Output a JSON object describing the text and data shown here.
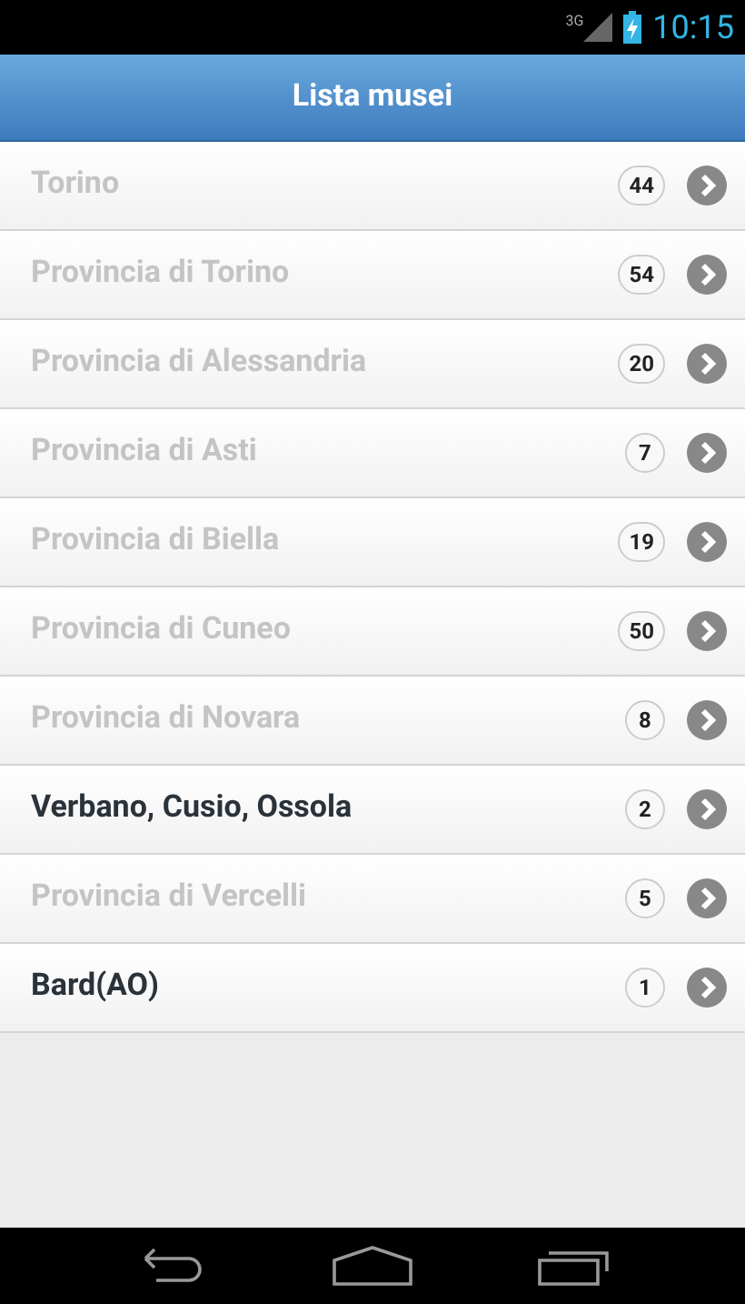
{
  "status_bar": {
    "network": "3G",
    "time": "10:15"
  },
  "header": {
    "title": "Lista musei"
  },
  "items": [
    {
      "label": "Torino",
      "count": "44",
      "disabled": true
    },
    {
      "label": "Provincia di Torino",
      "count": "54",
      "disabled": true
    },
    {
      "label": "Provincia di Alessandria",
      "count": "20",
      "disabled": true
    },
    {
      "label": "Provincia di Asti",
      "count": "7",
      "disabled": true
    },
    {
      "label": "Provincia di Biella",
      "count": "19",
      "disabled": true
    },
    {
      "label": "Provincia di Cuneo",
      "count": "50",
      "disabled": true
    },
    {
      "label": "Provincia di Novara",
      "count": "8",
      "disabled": true
    },
    {
      "label": "Verbano, Cusio, Ossola",
      "count": "2",
      "disabled": false
    },
    {
      "label": "Provincia di Vercelli",
      "count": "5",
      "disabled": true
    },
    {
      "label": "Bard(AO)",
      "count": "1",
      "disabled": false
    }
  ]
}
